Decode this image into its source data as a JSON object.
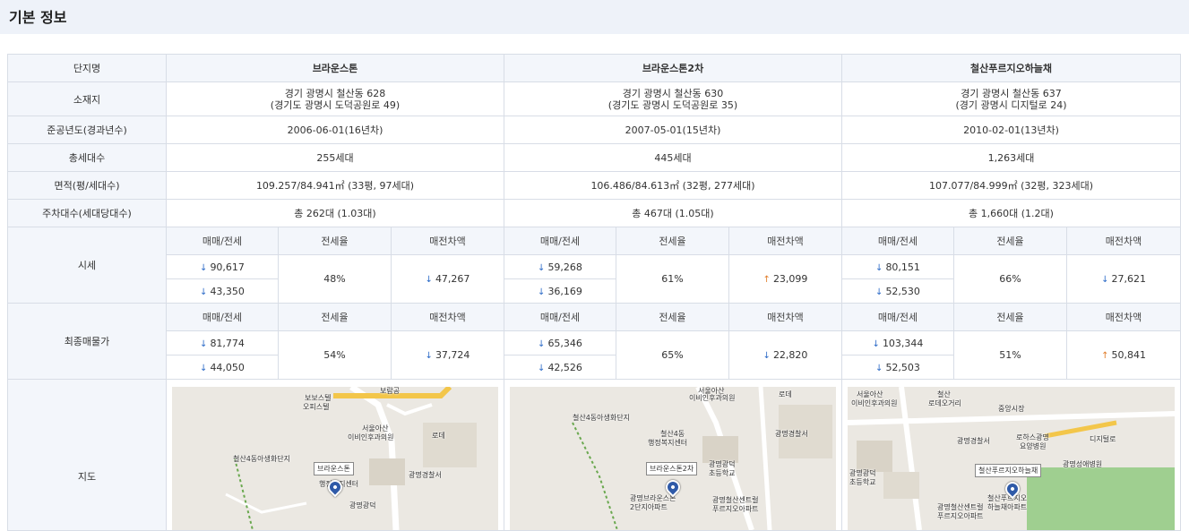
{
  "header": {
    "title": "기본 정보"
  },
  "labels": {
    "name": "단지명",
    "location": "소재지",
    "year": "준공년도(경과년수)",
    "households": "총세대수",
    "area": "면적(평/세대수)",
    "parking": "주차대수(세대당대수)",
    "price": "시세",
    "final_price": "최종매물가",
    "map": "지도"
  },
  "sub_headers": {
    "trade_jeonse": "매매/전세",
    "jeonse_rate": "전세율",
    "gap": "매전차액"
  },
  "complexes": [
    {
      "name": "브라운스톤",
      "addr1": "경기 광명시 철산동 628",
      "addr2": "(경기도 광명시 도덕공원로 49)",
      "year": "2006-06-01(16년차)",
      "households": "255세대",
      "area": "109.257/84.941㎡ (33평, 97세대)",
      "parking": "총 262대 (1.03대)",
      "price": {
        "trade": "90,617",
        "jeonse": "43,350",
        "rate": "48%",
        "gap": "47,267",
        "gap_dir": "down"
      },
      "final": {
        "trade": "81,774",
        "jeonse": "44,050",
        "rate": "54%",
        "gap": "37,724",
        "gap_dir": "down"
      },
      "map": {
        "callout": "브라운스톤",
        "labels": [
          "보보스텔",
          "오피스텔",
          "보람공",
          "서울아산",
          "이비인후과의원",
          "철산4동아생화단지",
          "행정복지센터",
          "광명경찰서",
          "광명광덕",
          "로데"
        ]
      }
    },
    {
      "name": "브라운스톤2차",
      "addr1": "경기 광명시 철산동 630",
      "addr2": "(경기도 광명시 도덕공원로 35)",
      "year": "2007-05-01(15년차)",
      "households": "445세대",
      "area": "106.486/84.613㎡ (32평, 277세대)",
      "parking": "총 467대 (1.05대)",
      "price": {
        "trade": "59,268",
        "jeonse": "36,169",
        "rate": "61%",
        "gap": "23,099",
        "gap_dir": "up"
      },
      "final": {
        "trade": "65,346",
        "jeonse": "42,526",
        "rate": "65%",
        "gap": "22,820",
        "gap_dir": "down"
      },
      "map": {
        "callout": "브라운스톤2차",
        "labels": [
          "서울아산",
          "이비인후과의원",
          "철산4동아생화단지",
          "철산4동",
          "행정복지센터",
          "광명경찰서",
          "광명광덕",
          "초등학교",
          "광명철산센트럴",
          "푸르지오아파트",
          "광명브라운스톤",
          "2단지아파트",
          "로데"
        ]
      }
    },
    {
      "name": "철산푸르지오하늘채",
      "addr1": "경기 광명시 철산동 637",
      "addr2": "(경기 광명시 디지털로 24)",
      "year": "2010-02-01(13년차)",
      "households": "1,263세대",
      "area": "107.077/84.999㎡ (32평, 323세대)",
      "parking": "총 1,660대 (1.2대)",
      "price": {
        "trade": "80,151",
        "jeonse": "52,530",
        "rate": "66%",
        "gap": "27,621",
        "gap_dir": "down"
      },
      "final": {
        "trade": "103,344",
        "jeonse": "52,503",
        "rate": "51%",
        "gap": "50,841",
        "gap_dir": "up"
      },
      "map": {
        "callout": "철산푸르지오하늘채",
        "labels": [
          "서울아산",
          "이비인후과의원",
          "철산",
          "로데오거리",
          "중앙시장",
          "광명경찰서",
          "로하스광명",
          "요양병원",
          "광명성애병원",
          "광명광덕",
          "초등학교",
          "광명철산센트럴",
          "푸르지오아파트",
          "철산푸르지오",
          "하늘채아파트",
          "디지털로"
        ]
      }
    }
  ],
  "colors": {
    "down_arrow": "#2e6cc8",
    "up_arrow": "#e07b27",
    "pin": "#2f5aa8",
    "road": "#f3c64a"
  },
  "icons": {
    "down": "arrow-down-icon",
    "up": "arrow-up-icon",
    "pin": "map-pin-icon"
  },
  "arrows": {
    "down": "↓",
    "up": "↑"
  }
}
